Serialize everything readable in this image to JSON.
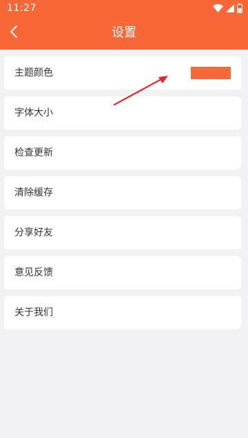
{
  "status_bar": {
    "time": "11:27",
    "icons": [
      "wifi-icon",
      "cell-signal-icon",
      "battery-icon"
    ]
  },
  "toolbar": {
    "title": "设置",
    "back_icon": "chevron-left-icon"
  },
  "settings": {
    "items": [
      {
        "label": "主题颜色"
      },
      {
        "label": "字体大小"
      },
      {
        "label": "检查更新"
      },
      {
        "label": "清除缓存"
      },
      {
        "label": "分享好友"
      },
      {
        "label": "意见反馈"
      },
      {
        "label": "关于我们"
      }
    ]
  },
  "colors": {
    "accent": "#f76738",
    "background": "#f1f1f3",
    "card": "#ffffff",
    "text": "#333333",
    "annotation": "#e8262a"
  }
}
